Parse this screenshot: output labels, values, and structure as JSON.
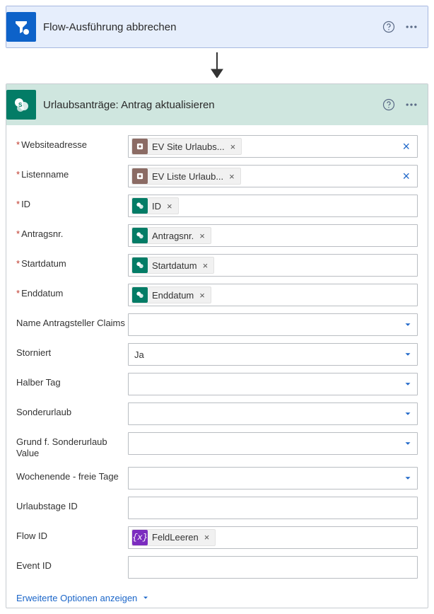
{
  "cancelCard": {
    "title": "Flow-Ausführung abbrechen"
  },
  "spCard": {
    "title": "Urlaubsanträge: Antrag aktualisieren",
    "fields": {
      "site": {
        "label": "Websiteadresse",
        "token": "EV Site Urlaubs..."
      },
      "list": {
        "label": "Listenname",
        "token": "EV Liste Urlaub..."
      },
      "id": {
        "label": "ID",
        "token": "ID"
      },
      "reqno": {
        "label": "Antragsnr.",
        "token": "Antragsnr."
      },
      "start": {
        "label": "Startdatum",
        "token": "Startdatum"
      },
      "end": {
        "label": "Enddatum",
        "token": "Enddatum"
      },
      "claims": {
        "label": "Name Antragsteller Claims",
        "value": ""
      },
      "storniert": {
        "label": "Storniert",
        "value": "Ja"
      },
      "halbtag": {
        "label": "Halber Tag",
        "value": ""
      },
      "sonder": {
        "label": "Sonderurlaub",
        "value": ""
      },
      "sonderGrund": {
        "label": "Grund f. Sonderurlaub Value",
        "value": ""
      },
      "wochenende": {
        "label": "Wochenende - freie Tage",
        "value": ""
      },
      "urlaubstage": {
        "label": "Urlaubstage ID",
        "value": ""
      },
      "flowid": {
        "label": "Flow ID",
        "token": "FeldLeeren"
      },
      "eventid": {
        "label": "Event ID",
        "value": ""
      }
    },
    "advanced": "Erweiterte Optionen anzeigen",
    "exprGlyph": "{x}"
  }
}
